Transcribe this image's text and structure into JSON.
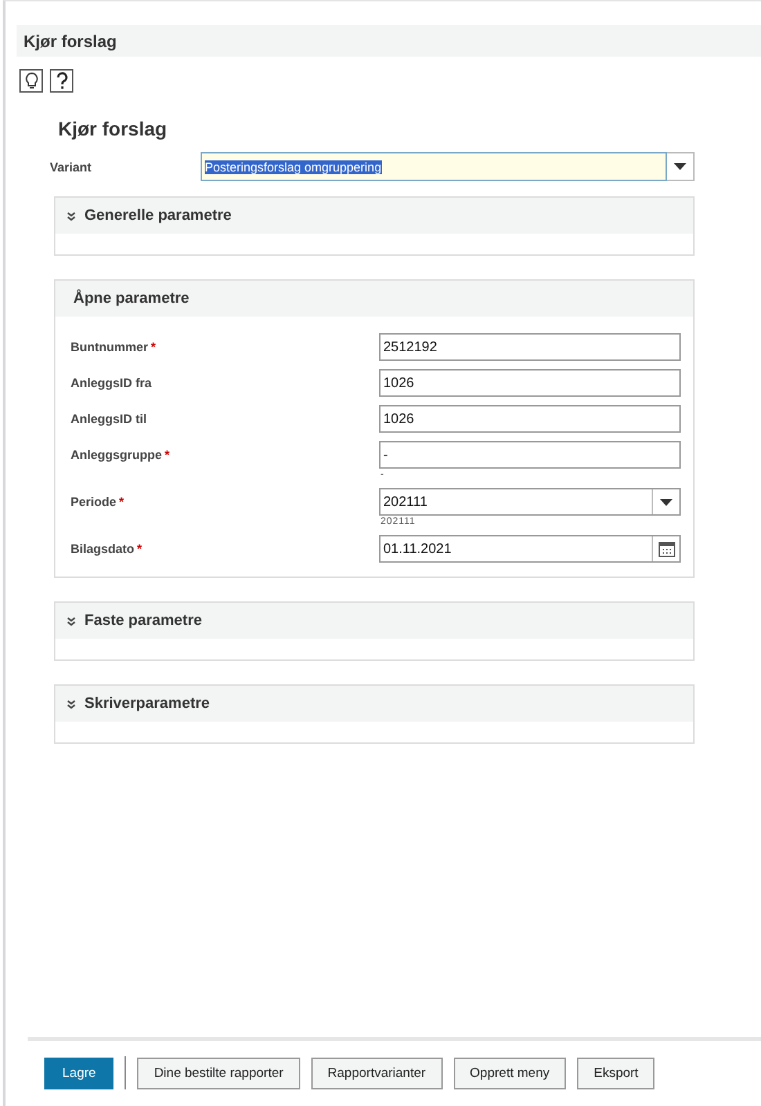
{
  "header": {
    "title": "Kjør forslag"
  },
  "form_title": "Kjør forslag",
  "variant": {
    "label": "Variant",
    "value": "Posteringsforslag omgruppering",
    "selected_text": true
  },
  "sections": [
    {
      "title": "Generelle parametre",
      "expanded": false
    },
    {
      "title": "Åpne parametre",
      "expanded": true,
      "fields": [
        {
          "label": "Buntnummer",
          "required_mark": "*",
          "kind": "text",
          "value": "2512192"
        },
        {
          "label": "AnleggsID fra",
          "kind": "text",
          "value": "1026"
        },
        {
          "label": "AnleggsID til",
          "kind": "text",
          "value": "1026"
        },
        {
          "label": "Anleggsgruppe",
          "required_mark": "*",
          "kind": "text",
          "value": "-",
          "hint": "-"
        },
        {
          "label": "Periode",
          "required_mark": "*",
          "kind": "dropdown",
          "value": "202111",
          "hint": "202111"
        },
        {
          "label": "Bilagsdato",
          "required_mark": "*",
          "kind": "date",
          "value": "01.11.2021"
        }
      ]
    },
    {
      "title": "Faste parametre",
      "expanded": false
    },
    {
      "title": "Skriverparametre",
      "expanded": false
    }
  ],
  "buttons": [
    {
      "label": "Lagre",
      "kind": "primary"
    },
    {
      "label": "Dine bestilte rapporter",
      "kind": "secondary"
    },
    {
      "label": "Rapportvarianter",
      "kind": "secondary"
    },
    {
      "label": "Opprett meny",
      "kind": "secondary"
    },
    {
      "label": "Eksport",
      "kind": "secondary"
    }
  ]
}
